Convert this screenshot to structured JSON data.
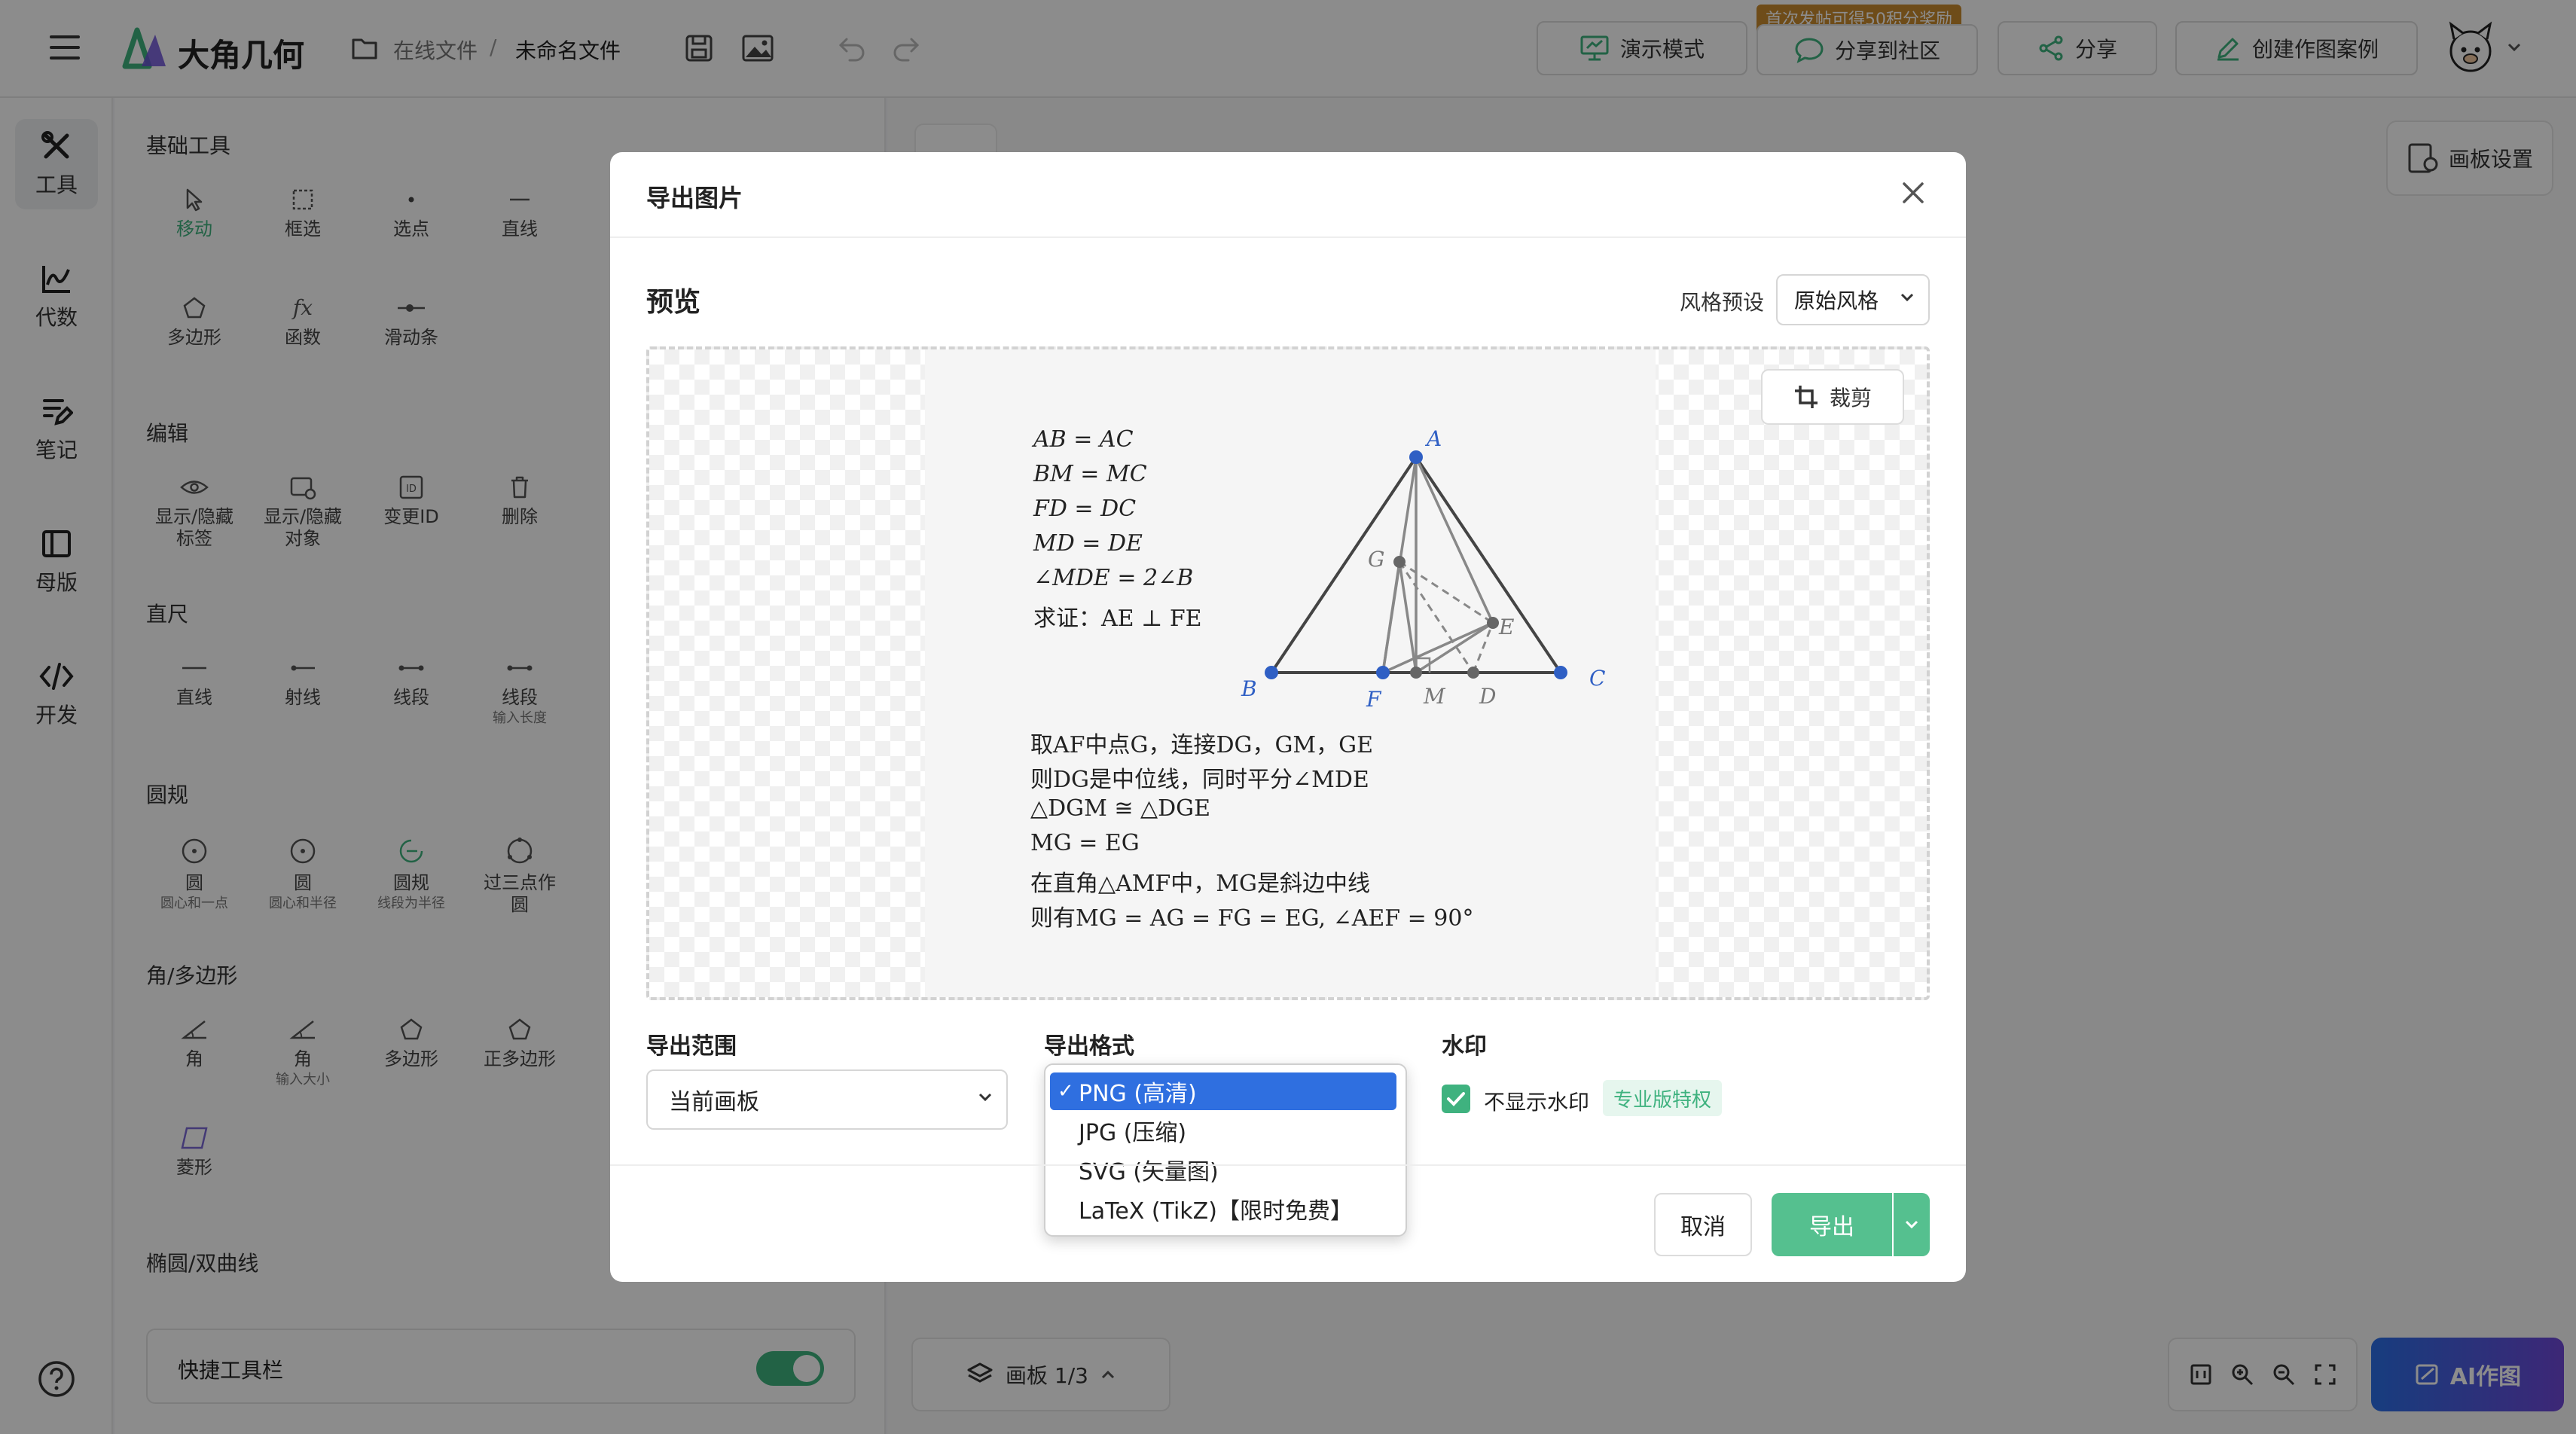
{
  "app": {
    "name": "大角几何"
  },
  "breadcrumb": {
    "root": "在线文件",
    "separator": "/",
    "file": "未命名文件"
  },
  "toolbar": {
    "demo_label": "演示模式",
    "share_community_label": "分享到社区",
    "share_badge": "首次发帖可得50积分奖励",
    "share_label": "分享",
    "create_case_label": "创建作图案例"
  },
  "sidebar": {
    "items": [
      {
        "label": "工具",
        "icon": "tools-icon"
      },
      {
        "label": "代数",
        "icon": "chart-icon"
      },
      {
        "label": "笔记",
        "icon": "notes-icon"
      },
      {
        "label": "母版",
        "icon": "template-icon"
      },
      {
        "label": "开发",
        "icon": "code-icon"
      }
    ]
  },
  "tools": {
    "sections": {
      "basic": "基础工具",
      "edit": "编辑",
      "ruler": "直尺",
      "compass": "圆规",
      "angle": "角/多边形",
      "ellipse": "椭圆/双曲线"
    },
    "basic": [
      "移动",
      "框选",
      "选点",
      "直线",
      "多边形",
      "函数",
      "滑动条"
    ],
    "edit": [
      {
        "l1": "显示/隐藏",
        "l2": "标签"
      },
      {
        "l1": "显示/隐藏",
        "l2": "对象"
      },
      {
        "l1": "变更ID",
        "l2": ""
      },
      {
        "l1": "删除",
        "l2": ""
      }
    ],
    "ruler": [
      {
        "label": "直线",
        "sub": ""
      },
      {
        "label": "射线",
        "sub": ""
      },
      {
        "label": "线段",
        "sub": ""
      },
      {
        "label": "线段",
        "sub": "输入长度"
      }
    ],
    "compass": [
      {
        "label": "圆",
        "sub": "圆心和一点"
      },
      {
        "label": "圆",
        "sub": "圆心和半径"
      },
      {
        "label": "圆规",
        "sub": "线段为半径"
      },
      {
        "label": "过三点作",
        "sub": "圆"
      }
    ],
    "angle": [
      {
        "label": "角",
        "sub": ""
      },
      {
        "label": "角",
        "sub": "输入大小"
      },
      {
        "label": "多边形",
        "sub": ""
      },
      {
        "label": "正多边形",
        "sub": ""
      },
      {
        "label": "菱形",
        "sub": ""
      }
    ],
    "quick_toolbar": "快捷工具栏",
    "quick_toolbar_on": true
  },
  "canvas": {
    "settings_label": "画板设置",
    "board_label": "画板 1/3",
    "ai_label": "AI作图"
  },
  "dialog": {
    "title": "导出图片",
    "preview_label": "预览",
    "style_label": "风格预设",
    "style_value": "原始风格",
    "crop_label": "裁剪",
    "range_label": "导出范围",
    "range_value": "当前画板",
    "format_label": "导出格式",
    "format_options": [
      "PNG (高清)",
      "JPG (压缩)",
      "SVG (矢量图)",
      "LaTeX (TikZ)【限时免费】"
    ],
    "format_selected": "PNG (高清)",
    "watermark_label": "水印",
    "no_watermark_label": "不显示水印",
    "no_watermark_checked": true,
    "pro_badge": "专业版特权",
    "cancel_label": "取消",
    "export_label": "导出"
  },
  "preview": {
    "given": [
      "AB = AC",
      "BM = MC",
      "FD = DC",
      "MD = DE",
      "∠MDE = 2∠B",
      "求证：AE ⊥ FE"
    ],
    "proof": [
      "取AF中点G，连接DG，GM，GE",
      "则DG是中位线，同时平分∠MDE",
      "△DGM ≅ △DGE",
      "MG = EG",
      "在直角△AMF中，MG是斜边中线",
      "则有MG = AG = FG = EG, ∠AEF = 90°"
    ],
    "points": [
      "A",
      "B",
      "C",
      "F",
      "M",
      "D",
      "G",
      "E"
    ]
  },
  "colors": {
    "accent": "#3fb27f",
    "point": "#2f5fc4",
    "selected": "#2f6fe0"
  }
}
